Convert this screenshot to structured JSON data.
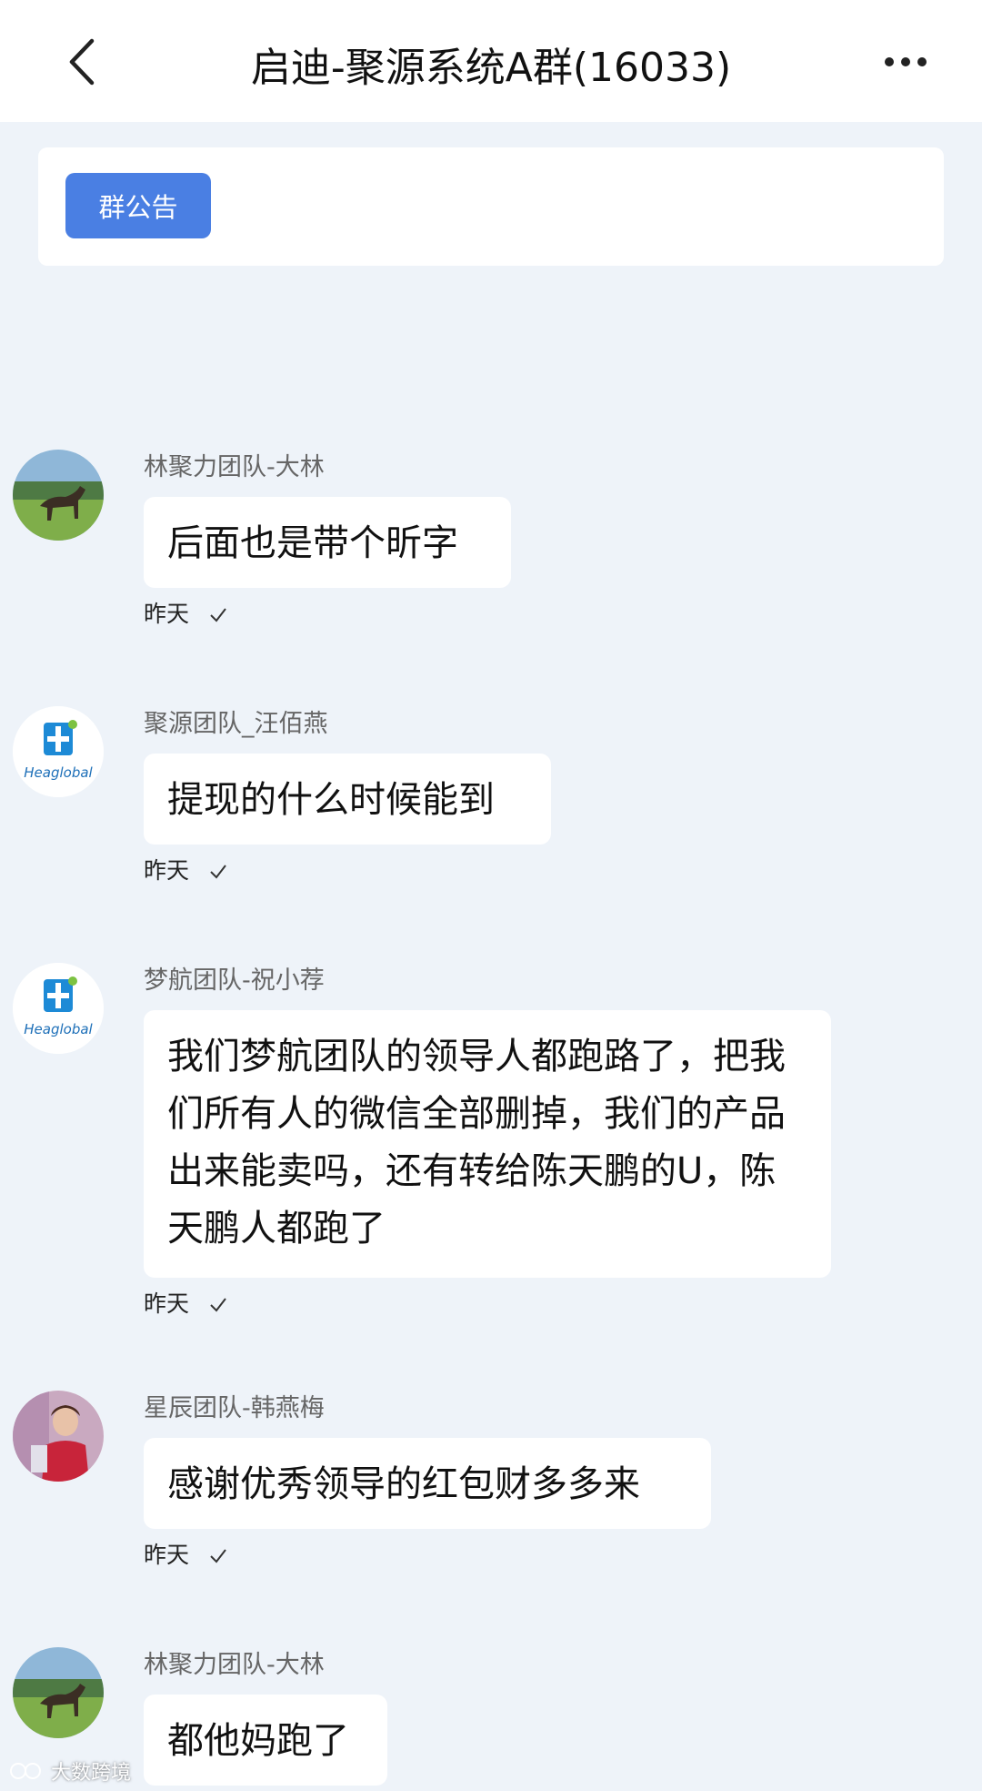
{
  "header": {
    "title": "启迪-聚源系统A群(16033)"
  },
  "notice": {
    "button_label": "群公告"
  },
  "messages": [
    {
      "sender": "林聚力团队-大林",
      "text": "后面也是带个昕字",
      "time": "昨天",
      "avatar": "horse-avatar-icon"
    },
    {
      "sender": "聚源团队_汪佰燕",
      "text": "提现的什么时候能到",
      "time": "昨天",
      "avatar": "heaglobal-logo-avatar",
      "avatar_text": "Heaglobal"
    },
    {
      "sender": "梦航团队-祝小荐",
      "text": "我们梦航团队的领导人都跑路了，把我们所有人的微信全部删掉，我们的产品出来能卖吗，还有转给陈天鹏的U，陈天鹏人都跑了",
      "time": "昨天",
      "avatar": "heaglobal-logo-avatar",
      "avatar_text": "Heaglobal"
    },
    {
      "sender": "星辰团队-韩燕梅",
      "text": "感谢优秀领导的红包财多多来",
      "time": "昨天",
      "avatar": "person-avatar-icon"
    },
    {
      "sender": "林聚力团队-大林",
      "text": "都他妈跑了",
      "time": "",
      "avatar": "horse-avatar-icon"
    }
  ],
  "watermark": {
    "text": "大数跨境"
  },
  "colors": {
    "accent": "#4a7fe3",
    "background": "#eef3f9",
    "bubble": "#ffffff"
  }
}
